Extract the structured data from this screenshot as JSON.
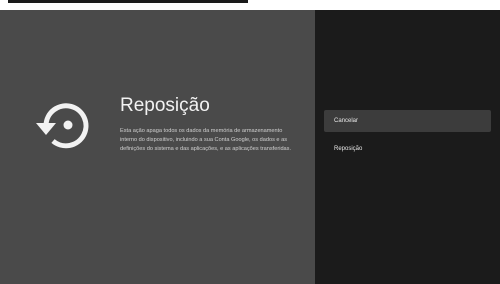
{
  "screen": {
    "title": "Reposição",
    "description": "Esta ação apaga todos os dados da memória de armazenamento interno do dispositivo, incluindo a sua Conta Google, os dados e as definições do sistema e das aplicações, e as aplicações transferidas."
  },
  "icon": "restore-icon",
  "menu": {
    "items": [
      {
        "label": "Cancelar",
        "selected": true
      },
      {
        "label": "Reposição",
        "selected": false
      }
    ]
  },
  "colors": {
    "info_background": "#4a4a4a",
    "menu_background": "#1b1b1b",
    "selected_item": "#3c3c3c",
    "text": "#f2f2f2"
  }
}
